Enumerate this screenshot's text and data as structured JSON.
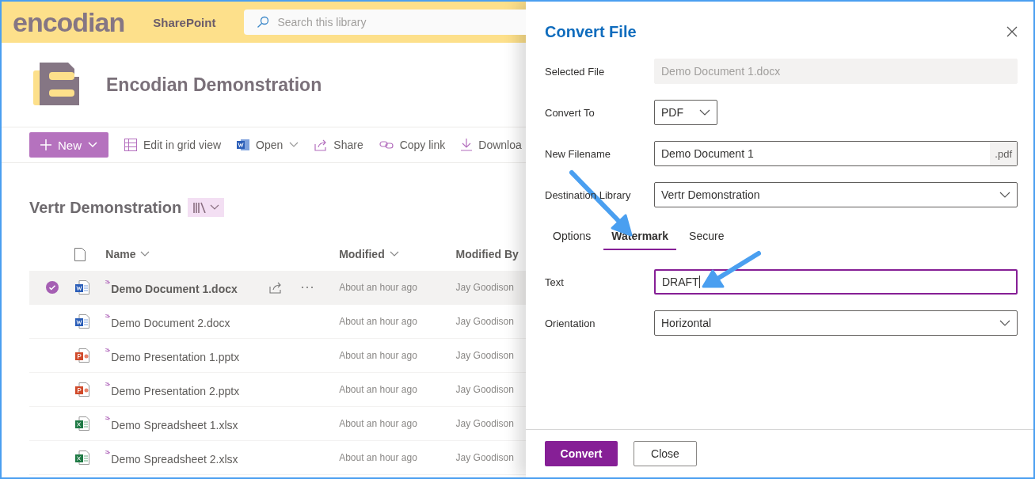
{
  "header": {
    "logo": "encodian",
    "site": "SharePoint",
    "search": {
      "placeholder": "Search this library"
    }
  },
  "site_title": "Encodian Demonstration",
  "command_bar": [
    {
      "kind": "new",
      "label": "New"
    },
    {
      "kind": "grid",
      "label": "Edit in grid view"
    },
    {
      "kind": "open",
      "label": "Open"
    },
    {
      "kind": "share",
      "label": "Share"
    },
    {
      "kind": "link",
      "label": "Copy link"
    },
    {
      "kind": "download",
      "label": "Downloa"
    }
  ],
  "library_title": "Vertr Demonstration",
  "table": {
    "columns": [
      "Name",
      "Modified",
      "Modified By"
    ],
    "rows": [
      {
        "name": "Demo Document 1.docx",
        "kind": "word",
        "modified": "About an hour ago",
        "modified_by": "Jay Goodison",
        "selected": true
      },
      {
        "name": "Demo Document 2.docx",
        "kind": "word",
        "modified": "About an hour ago",
        "modified_by": "Jay Goodison",
        "selected": false
      },
      {
        "name": "Demo Presentation 1.pptx",
        "kind": "powerpoint",
        "modified": "About an hour ago",
        "modified_by": "Jay Goodison",
        "selected": false
      },
      {
        "name": "Demo Presentation 2.pptx",
        "kind": "powerpoint",
        "modified": "About an hour ago",
        "modified_by": "Jay Goodison",
        "selected": false
      },
      {
        "name": "Demo Spreadsheet 1.xlsx",
        "kind": "excel",
        "modified": "About an hour ago",
        "modified_by": "Jay Goodison",
        "selected": false
      },
      {
        "name": "Demo Spreadsheet 2.xlsx",
        "kind": "excel",
        "modified": "About an hour ago",
        "modified_by": "Jay Goodison",
        "selected": false
      }
    ]
  },
  "panel": {
    "title": "Convert File",
    "fields": [
      {
        "label": "Selected File",
        "kind": "readonly",
        "value": "Demo Document 1.docx"
      },
      {
        "label": "Convert To",
        "kind": "small-dropdown",
        "value": "PDF"
      },
      {
        "label": "New Filename",
        "kind": "suffix",
        "value": "Demo Document 1",
        "suffix": ".pdf"
      },
      {
        "label": "Destination Library",
        "kind": "dropdown",
        "value": "Vertr Demonstration"
      }
    ],
    "tabs": [
      {
        "label": "Options",
        "selected": false
      },
      {
        "label": "Watermark",
        "selected": true
      },
      {
        "label": "Secure",
        "selected": false
      }
    ],
    "tab_fields": [
      {
        "label": "Text",
        "kind": "text",
        "value": "DRAFT",
        "focused": true
      },
      {
        "label": "Orientation",
        "kind": "dropdown",
        "value": "Horizontal"
      }
    ],
    "buttons": [
      {
        "label": "Convert",
        "kind": "primary"
      },
      {
        "label": "Close",
        "kind": "default"
      }
    ]
  }
}
